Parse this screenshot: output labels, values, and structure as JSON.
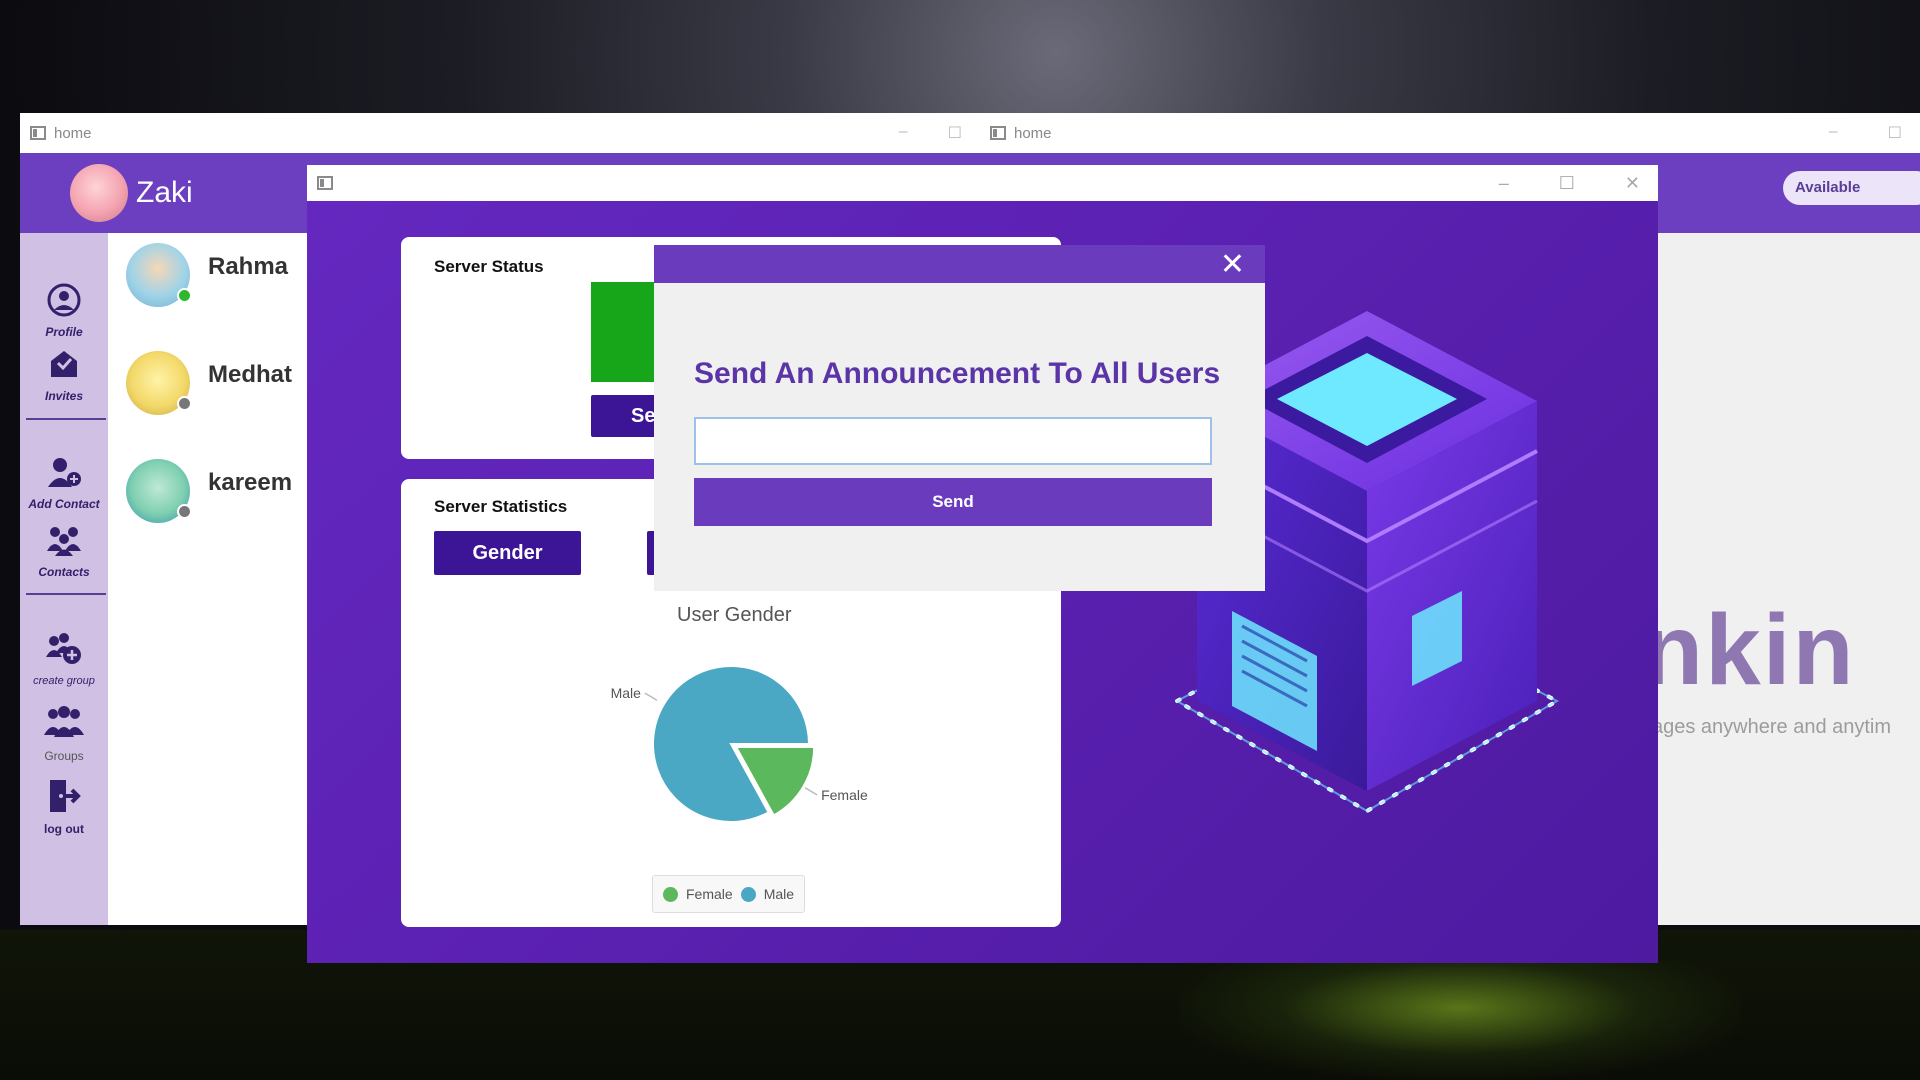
{
  "windows": {
    "left": {
      "title": "home",
      "user": {
        "name": "Zaki"
      },
      "nav": [
        {
          "label": "Profile",
          "icon": "profile-icon"
        },
        {
          "label": "Invites",
          "icon": "invites-icon"
        },
        {
          "label": "Add Contact",
          "icon": "add-contact-icon"
        },
        {
          "label": "Contacts",
          "icon": "contacts-icon"
        },
        {
          "label": "create group",
          "icon": "create-group-icon"
        },
        {
          "label": "Groups",
          "icon": "groups-icon"
        },
        {
          "label": "log out",
          "icon": "logout-icon"
        }
      ],
      "contacts": [
        {
          "name": "Rahma",
          "online": true
        },
        {
          "name": "Medhat",
          "online": false
        },
        {
          "name": "kareem",
          "online": false
        }
      ]
    },
    "right": {
      "title": "home",
      "status": "Available",
      "brand": "nkin",
      "tagline": "ages anywhere and anytim"
    }
  },
  "admin": {
    "server_status": {
      "title": "Server Status",
      "button_label": "Se"
    },
    "server_statistics": {
      "title": "Server Statistics",
      "tab_gender": "Gender",
      "chart": {
        "title": "User Gender",
        "label_male": "Male",
        "label_female": "Female",
        "legend": [
          "Female",
          "Male"
        ]
      }
    }
  },
  "dialog": {
    "title": "Send An Announcement To All Users",
    "input_value": "",
    "send_label": "Send"
  },
  "colors": {
    "accent": "#6a3cbd",
    "dark_button": "#3c1496",
    "online": "#2eb82e",
    "offline": "#777777",
    "female": "#5cb85c",
    "male": "#4aa8c4"
  },
  "chart_data": {
    "type": "pie",
    "title": "User Gender",
    "categories": [
      "Male",
      "Female"
    ],
    "values": [
      83,
      17
    ],
    "legend": [
      "Female",
      "Male"
    ]
  }
}
